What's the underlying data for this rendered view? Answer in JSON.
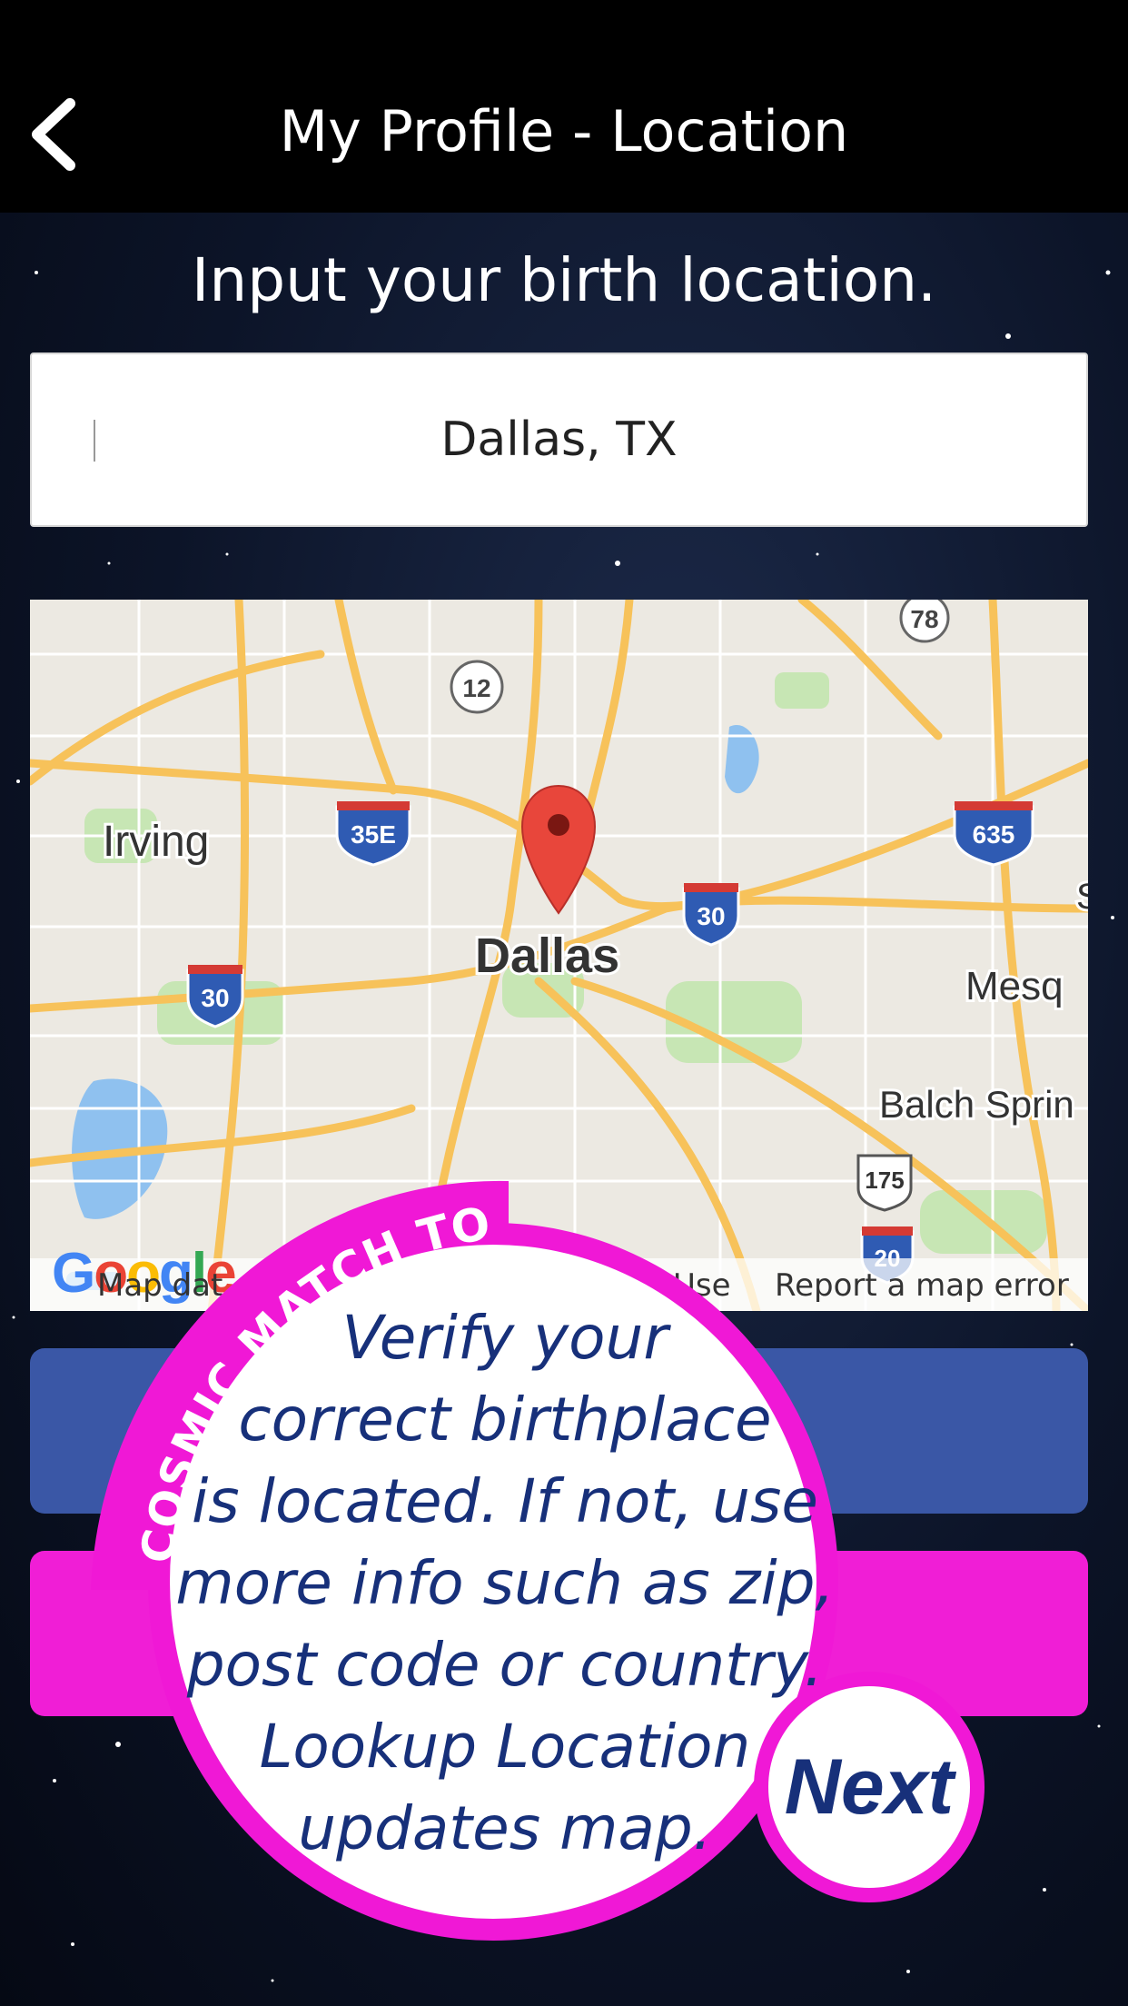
{
  "header": {
    "title": "My Profile - Location",
    "back_icon": "chevron-left-icon"
  },
  "prompt": "Input your birth location.",
  "location_input": {
    "value": "Dallas, TX"
  },
  "map": {
    "center_label": "Dallas",
    "labels": [
      "Irving",
      "Mesq",
      "Balch Sprin",
      "S"
    ],
    "shields": [
      "12",
      "78",
      "35E",
      "635",
      "30",
      "30",
      "175",
      "20"
    ],
    "footer": {
      "data_text": "Map dat",
      "terms_text": "Use",
      "report_text": "Report a map error",
      "logo_text": "Google"
    },
    "colors": {
      "highway": "#f7c25a",
      "water": "#8fc1ef",
      "park": "#c7e6b4",
      "pin": "#e8463b"
    }
  },
  "tour": {
    "ribbon_text": "COSMIC MATCH TOUR",
    "lines": [
      "Verify your",
      "correct birthplace",
      "is located. If not, use",
      "more info such as zip,",
      "post code or country.",
      "Lookup Location",
      "updates map."
    ],
    "next_label": "Next",
    "accent": "#f018d6",
    "text_color": "#17307a"
  },
  "buttons": {
    "lookup_color": "#3a57a6",
    "save_color": "#f01ed6"
  }
}
